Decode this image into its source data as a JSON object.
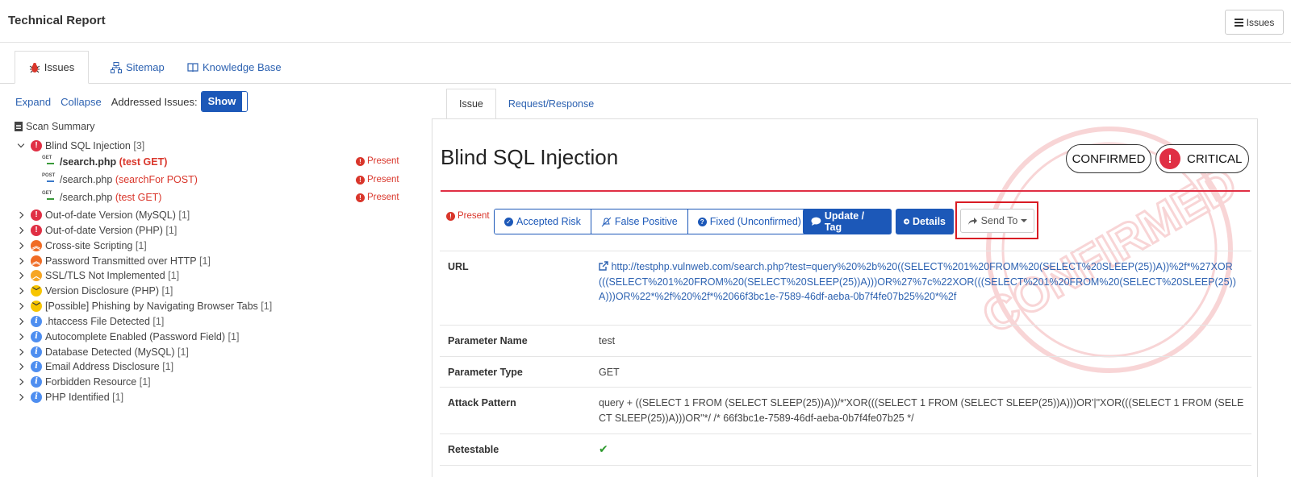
{
  "header": {
    "title": "Technical Report",
    "issues_button": "Issues"
  },
  "main_tabs": [
    {
      "label": "Issues",
      "icon": "bug-icon",
      "active": true
    },
    {
      "label": "Sitemap",
      "icon": "sitemap-icon",
      "active": false
    },
    {
      "label": "Knowledge Base",
      "icon": "book-icon",
      "active": false
    }
  ],
  "left_toolbar": {
    "expand": "Expand",
    "collapse": "Collapse",
    "addressed_label": "Addressed Issues:",
    "toggle": "Show"
  },
  "tree": {
    "summary": "Scan Summary",
    "groups": [
      {
        "label": "Blind SQL Injection",
        "count": "[3]",
        "severity": "critical",
        "expanded": true
      },
      {
        "label": "Out-of-date Version (MySQL)",
        "count": "[1]",
        "severity": "critical"
      },
      {
        "label": "Out-of-date Version (PHP)",
        "count": "[1]",
        "severity": "critical"
      },
      {
        "label": "Cross-site Scripting",
        "count": "[1]",
        "severity": "high"
      },
      {
        "label": "Password Transmitted over HTTP",
        "count": "[1]",
        "severity": "high"
      },
      {
        "label": "SSL/TLS Not Implemented",
        "count": "[1]",
        "severity": "medium"
      },
      {
        "label": "Version Disclosure (PHP)",
        "count": "[1]",
        "severity": "low"
      },
      {
        "label": "[Possible] Phishing by Navigating Browser Tabs",
        "count": "[1]",
        "severity": "low"
      },
      {
        "label": ".htaccess File Detected",
        "count": "[1]",
        "severity": "info"
      },
      {
        "label": "Autocomplete Enabled (Password Field)",
        "count": "[1]",
        "severity": "info"
      },
      {
        "label": "Database Detected (MySQL)",
        "count": "[1]",
        "severity": "info"
      },
      {
        "label": "Email Address Disclosure",
        "count": "[1]",
        "severity": "info"
      },
      {
        "label": "Forbidden Resource",
        "count": "[1]",
        "severity": "info"
      },
      {
        "label": "PHP Identified",
        "count": "[1]",
        "severity": "info"
      }
    ],
    "children": [
      {
        "method": "GET",
        "path": "/search.php",
        "param": "(test GET)",
        "status": "Present",
        "selected": true
      },
      {
        "method": "POST",
        "path": "/search.php",
        "param": "(searchFor POST)",
        "status": "Present",
        "selected": false
      },
      {
        "method": "GET",
        "path": "/search.php",
        "param": "(test GET)",
        "status": "Present",
        "selected": false
      }
    ]
  },
  "detail_tabs": [
    {
      "label": "Issue",
      "active": true
    },
    {
      "label": "Request/Response",
      "active": false
    }
  ],
  "issue": {
    "title": "Blind SQL Injection",
    "state_badge": "CONFIRMED",
    "severity_badge": "CRITICAL",
    "status": "Present",
    "actions": {
      "accepted_risk": "Accepted Risk",
      "false_positive": "False Positive",
      "fixed": "Fixed (Unconfirmed)",
      "update_tag": "Update / Tag",
      "details": "Details",
      "send_to": "Send To"
    },
    "fields": {
      "url_label": "URL",
      "url_value": "http://testphp.vulnweb.com/search.php?test=query%20%2b%20((SELECT%201%20FROM%20(SELECT%20SLEEP(25))A))%2f*%27XOR(((SELECT%201%20FROM%20(SELECT%20SLEEP(25))A)))OR%27%7c%22XOR(((SELECT%201%20FROM%20(SELECT%20SLEEP(25))A)))OR%22*%2f%20%2f*%2066f3bc1e-7589-46df-aeba-0b7f4fe07b25%20*%2f",
      "param_name_label": "Parameter Name",
      "param_name_value": "test",
      "param_type_label": "Parameter Type",
      "param_type_value": "GET",
      "attack_label": "Attack Pattern",
      "attack_value": "query + ((SELECT 1 FROM (SELECT SLEEP(25))A))/*'XOR(((SELECT 1 FROM (SELECT SLEEP(25))A)))OR'|\"XOR(((SELECT 1 FROM (SELECT SLEEP(25))A)))OR\"*/ /* 66f3bc1e-7589-46df-aeba-0b7f4fe07b25 */",
      "retestable_label": "Retestable"
    },
    "stamp_text": "CONFIRMED"
  },
  "colors": {
    "accent": "#1c58b8",
    "critical": "#e02f44",
    "link": "#2d62b1",
    "highlight_box": "#d91c24"
  }
}
